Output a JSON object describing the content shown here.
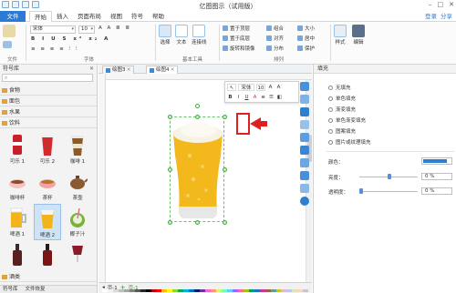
{
  "window": {
    "title": "亿图图示（试用版）"
  },
  "ribbon_tabs": {
    "file": "文件",
    "tabs": [
      "开始",
      "插入",
      "页面布局",
      "视图",
      "符号",
      "帮助"
    ],
    "active": "开始",
    "right": [
      "登录",
      "分享"
    ]
  },
  "ribbon": {
    "font_name": "宋体",
    "font_size": "10",
    "groups": {
      "file": "文件",
      "font": "字体",
      "tools": "基本工具",
      "arrange": "排列"
    },
    "select_label": "选择",
    "text_label": "文本",
    "connector_label": "连接线",
    "arrange_items": [
      "置于顶层",
      "置于底层",
      "旋转和镜像",
      "组合",
      "对齐",
      "分布",
      "大小",
      "居中",
      "保护"
    ],
    "style_label": "样式",
    "edit_label": "编辑"
  },
  "left_panel": {
    "title": "符号库",
    "categories": [
      "食物",
      "面包",
      "水果",
      "饮料"
    ],
    "symbols": [
      "可乐 1",
      "可乐 2",
      "咖啡 1",
      "咖啡杯",
      "茶杯",
      "茶壶",
      "啤酒 1",
      "啤酒 2",
      "椰子汁"
    ],
    "bottom_category": "酒类",
    "footer_tabs": [
      "符号库",
      "文件恢复"
    ]
  },
  "doc_tabs": [
    "绘图3",
    "绘图4"
  ],
  "canvas": {
    "mini_toolbar": {
      "font": "宋体",
      "size": "10",
      "bold": "B",
      "italic": "I",
      "underline": "U",
      "font_color": "A"
    },
    "page_label": "页-1",
    "page_current": "页-1"
  },
  "right_panel": {
    "title": "填充",
    "fill_options": [
      "无填充",
      "单色填充",
      "渐变填充",
      "单色渐变填充",
      "图案填充",
      "图片或纹理填充"
    ],
    "color_label": "颜色：",
    "brightness_label": "亮度：",
    "brightness_value": "0 %",
    "transparency_label": "透明度：",
    "transparency_value": "0 %",
    "fill_color": "#2f7fcf"
  },
  "colors": {
    "accent": "#2b7bd6",
    "highlight": "#e02020"
  },
  "palette": [
    "#ffffff",
    "#f2f2f2",
    "#d9d9d9",
    "#bfbfbf",
    "#a6a6a6",
    "#808080",
    "#595959",
    "#262626",
    "#000000",
    "#c00000",
    "#ff0000",
    "#ffc000",
    "#ffff00",
    "#92d050",
    "#00b050",
    "#00b0f0",
    "#0070c0",
    "#002060",
    "#7030a0",
    "#ff66cc",
    "#ff9966",
    "#ccff66",
    "#66ffcc",
    "#66ccff",
    "#9966ff",
    "#ff6699",
    "#99cc00",
    "#009999",
    "#3366cc",
    "#cc3399",
    "#996633",
    "#669999",
    "#cccc00",
    "#e6b8b7",
    "#b8cce4",
    "#d8e4bc",
    "#fcd5b4",
    "#ccc0da"
  ]
}
